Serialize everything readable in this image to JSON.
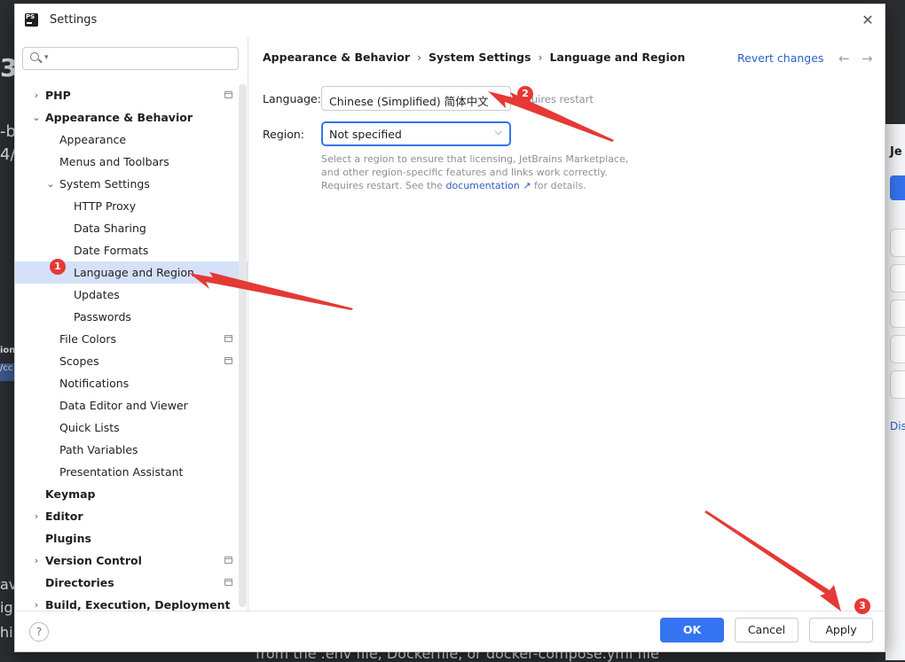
{
  "background": {
    "frag_big": "3",
    "frag_a": "-b",
    "frag_b": "4/",
    "frag_ion": "ion",
    "frag_cc": "/cc",
    "frag_av": "av",
    "frag_ig": "ig",
    "frag_hi": "hi",
    "frag_right_je": "Je",
    "frag_right_dis": "Dis",
    "bottom_text": "from the .env file, Dockerfile, or docker-compose.yml file"
  },
  "dialog": {
    "title": "Settings",
    "app_icon_text": "PS"
  },
  "search": {
    "placeholder": "",
    "value": ""
  },
  "tree": {
    "items": [
      {
        "label": "PHP",
        "bold": true,
        "expander": ">",
        "indent": 0,
        "pin": true
      },
      {
        "label": "Appearance & Behavior",
        "bold": true,
        "expander": "v",
        "indent": 0,
        "pin": false
      },
      {
        "label": "Appearance",
        "bold": false,
        "expander": "",
        "indent": 1,
        "pin": false
      },
      {
        "label": "Menus and Toolbars",
        "bold": false,
        "expander": "",
        "indent": 1,
        "pin": false
      },
      {
        "label": "System Settings",
        "bold": false,
        "expander": "v",
        "indent": 1,
        "pin": false
      },
      {
        "label": "HTTP Proxy",
        "bold": false,
        "expander": "",
        "indent": 2,
        "pin": false
      },
      {
        "label": "Data Sharing",
        "bold": false,
        "expander": "",
        "indent": 2,
        "pin": false
      },
      {
        "label": "Date Formats",
        "bold": false,
        "expander": "",
        "indent": 2,
        "pin": false
      },
      {
        "label": "Language and Region",
        "bold": false,
        "expander": "",
        "indent": 2,
        "pin": false,
        "selected": true
      },
      {
        "label": "Updates",
        "bold": false,
        "expander": "",
        "indent": 2,
        "pin": false
      },
      {
        "label": "Passwords",
        "bold": false,
        "expander": "",
        "indent": 2,
        "pin": false
      },
      {
        "label": "File Colors",
        "bold": false,
        "expander": "",
        "indent": 1,
        "pin": true
      },
      {
        "label": "Scopes",
        "bold": false,
        "expander": "",
        "indent": 1,
        "pin": true
      },
      {
        "label": "Notifications",
        "bold": false,
        "expander": "",
        "indent": 1,
        "pin": false
      },
      {
        "label": "Data Editor and Viewer",
        "bold": false,
        "expander": "",
        "indent": 1,
        "pin": false
      },
      {
        "label": "Quick Lists",
        "bold": false,
        "expander": "",
        "indent": 1,
        "pin": false
      },
      {
        "label": "Path Variables",
        "bold": false,
        "expander": "",
        "indent": 1,
        "pin": false
      },
      {
        "label": "Presentation Assistant",
        "bold": false,
        "expander": "",
        "indent": 1,
        "pin": false
      },
      {
        "label": "Keymap",
        "bold": true,
        "expander": "",
        "indent": 0,
        "pin": false
      },
      {
        "label": "Editor",
        "bold": true,
        "expander": ">",
        "indent": 0,
        "pin": false
      },
      {
        "label": "Plugins",
        "bold": true,
        "expander": "",
        "indent": 0,
        "pin": false
      },
      {
        "label": "Version Control",
        "bold": true,
        "expander": ">",
        "indent": 0,
        "pin": true
      },
      {
        "label": "Directories",
        "bold": true,
        "expander": "",
        "indent": 0,
        "pin": true
      },
      {
        "label": "Build, Execution, Deployment",
        "bold": true,
        "expander": ">",
        "indent": 0,
        "pin": false
      }
    ]
  },
  "breadcrumb": [
    "Appearance & Behavior",
    "System Settings",
    "Language and Region"
  ],
  "revert_label": "Revert changes",
  "language": {
    "label": "Language:",
    "value": "Chinese (Simplified) 简体中文",
    "note": "Requires restart"
  },
  "region": {
    "label": "Region:",
    "value": "Not specified",
    "help_before": "Select a region to ensure that licensing, JetBrains Marketplace, and other region-specific features and links work correctly. Requires restart. See the",
    "help_link": "documentation ↗",
    "help_after": "for details."
  },
  "buttons": {
    "help": "?",
    "ok": "OK",
    "cancel": "Cancel",
    "apply": "Apply"
  },
  "annotations": {
    "color": "#e53935",
    "badges": [
      "1",
      "2",
      "3"
    ]
  }
}
